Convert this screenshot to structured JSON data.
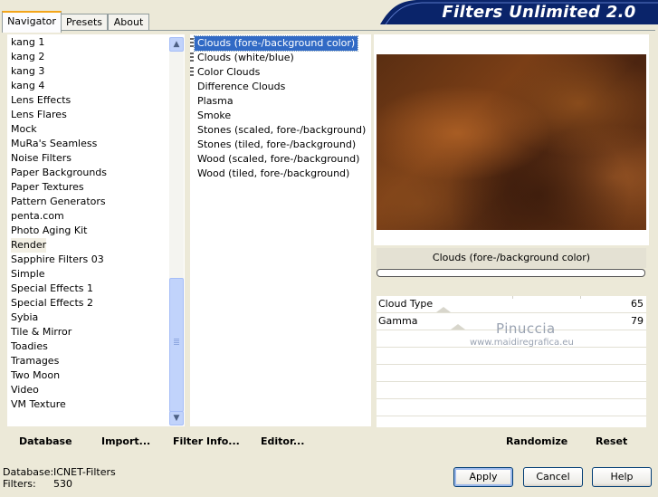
{
  "tabs": [
    "Navigator",
    "Presets",
    "About"
  ],
  "banner_title": "Filters Unlimited 2.0",
  "categories": [
    "kang 1",
    "kang 2",
    "kang 3",
    "kang 4",
    "Lens Effects",
    "Lens Flares",
    "Mock",
    "MuRa's Seamless",
    "Noise Filters",
    "Paper Backgrounds",
    "Paper Textures",
    "Pattern Generators",
    "penta.com",
    "Photo Aging Kit",
    "Render",
    "Sapphire Filters 03",
    "Simple",
    "Special Effects 1",
    "Special Effects 2",
    "Sybia",
    "Tile & Mirror",
    "Toadies",
    "Tramages",
    "Two Moon",
    "Video",
    "VM Texture"
  ],
  "filters": [
    "Clouds (fore-/background color)",
    "Clouds (white/blue)",
    "Color Clouds",
    "Difference Clouds",
    "Plasma",
    "Smoke",
    "Stones (scaled, fore-/background)",
    "Stones (tiled, fore-/background)",
    "Wood (scaled, fore-/background)",
    "Wood (tiled, fore-/background)"
  ],
  "preview_name": "Clouds (fore-/background color)",
  "params": [
    {
      "label": "Cloud Type",
      "value": "65"
    },
    {
      "label": "Gamma",
      "value": "79"
    }
  ],
  "watermark": {
    "name": "Pinuccia",
    "url": "www.maidiregrafica.eu"
  },
  "links": {
    "database": "Database",
    "import": "Import...",
    "filter_info": "Filter Info...",
    "editor": "Editor...",
    "randomize": "Randomize",
    "reset": "Reset"
  },
  "status": {
    "database_label": "Database:",
    "database_value": "ICNET-Filters",
    "filters_label": "Filters:",
    "filters_value": "530"
  },
  "buttons": {
    "apply": "Apply",
    "cancel": "Cancel",
    "help": "Help"
  },
  "colors": {
    "selection": "#316ac5",
    "banner": "#0a246a",
    "accent_tab": "#f3a51a"
  }
}
